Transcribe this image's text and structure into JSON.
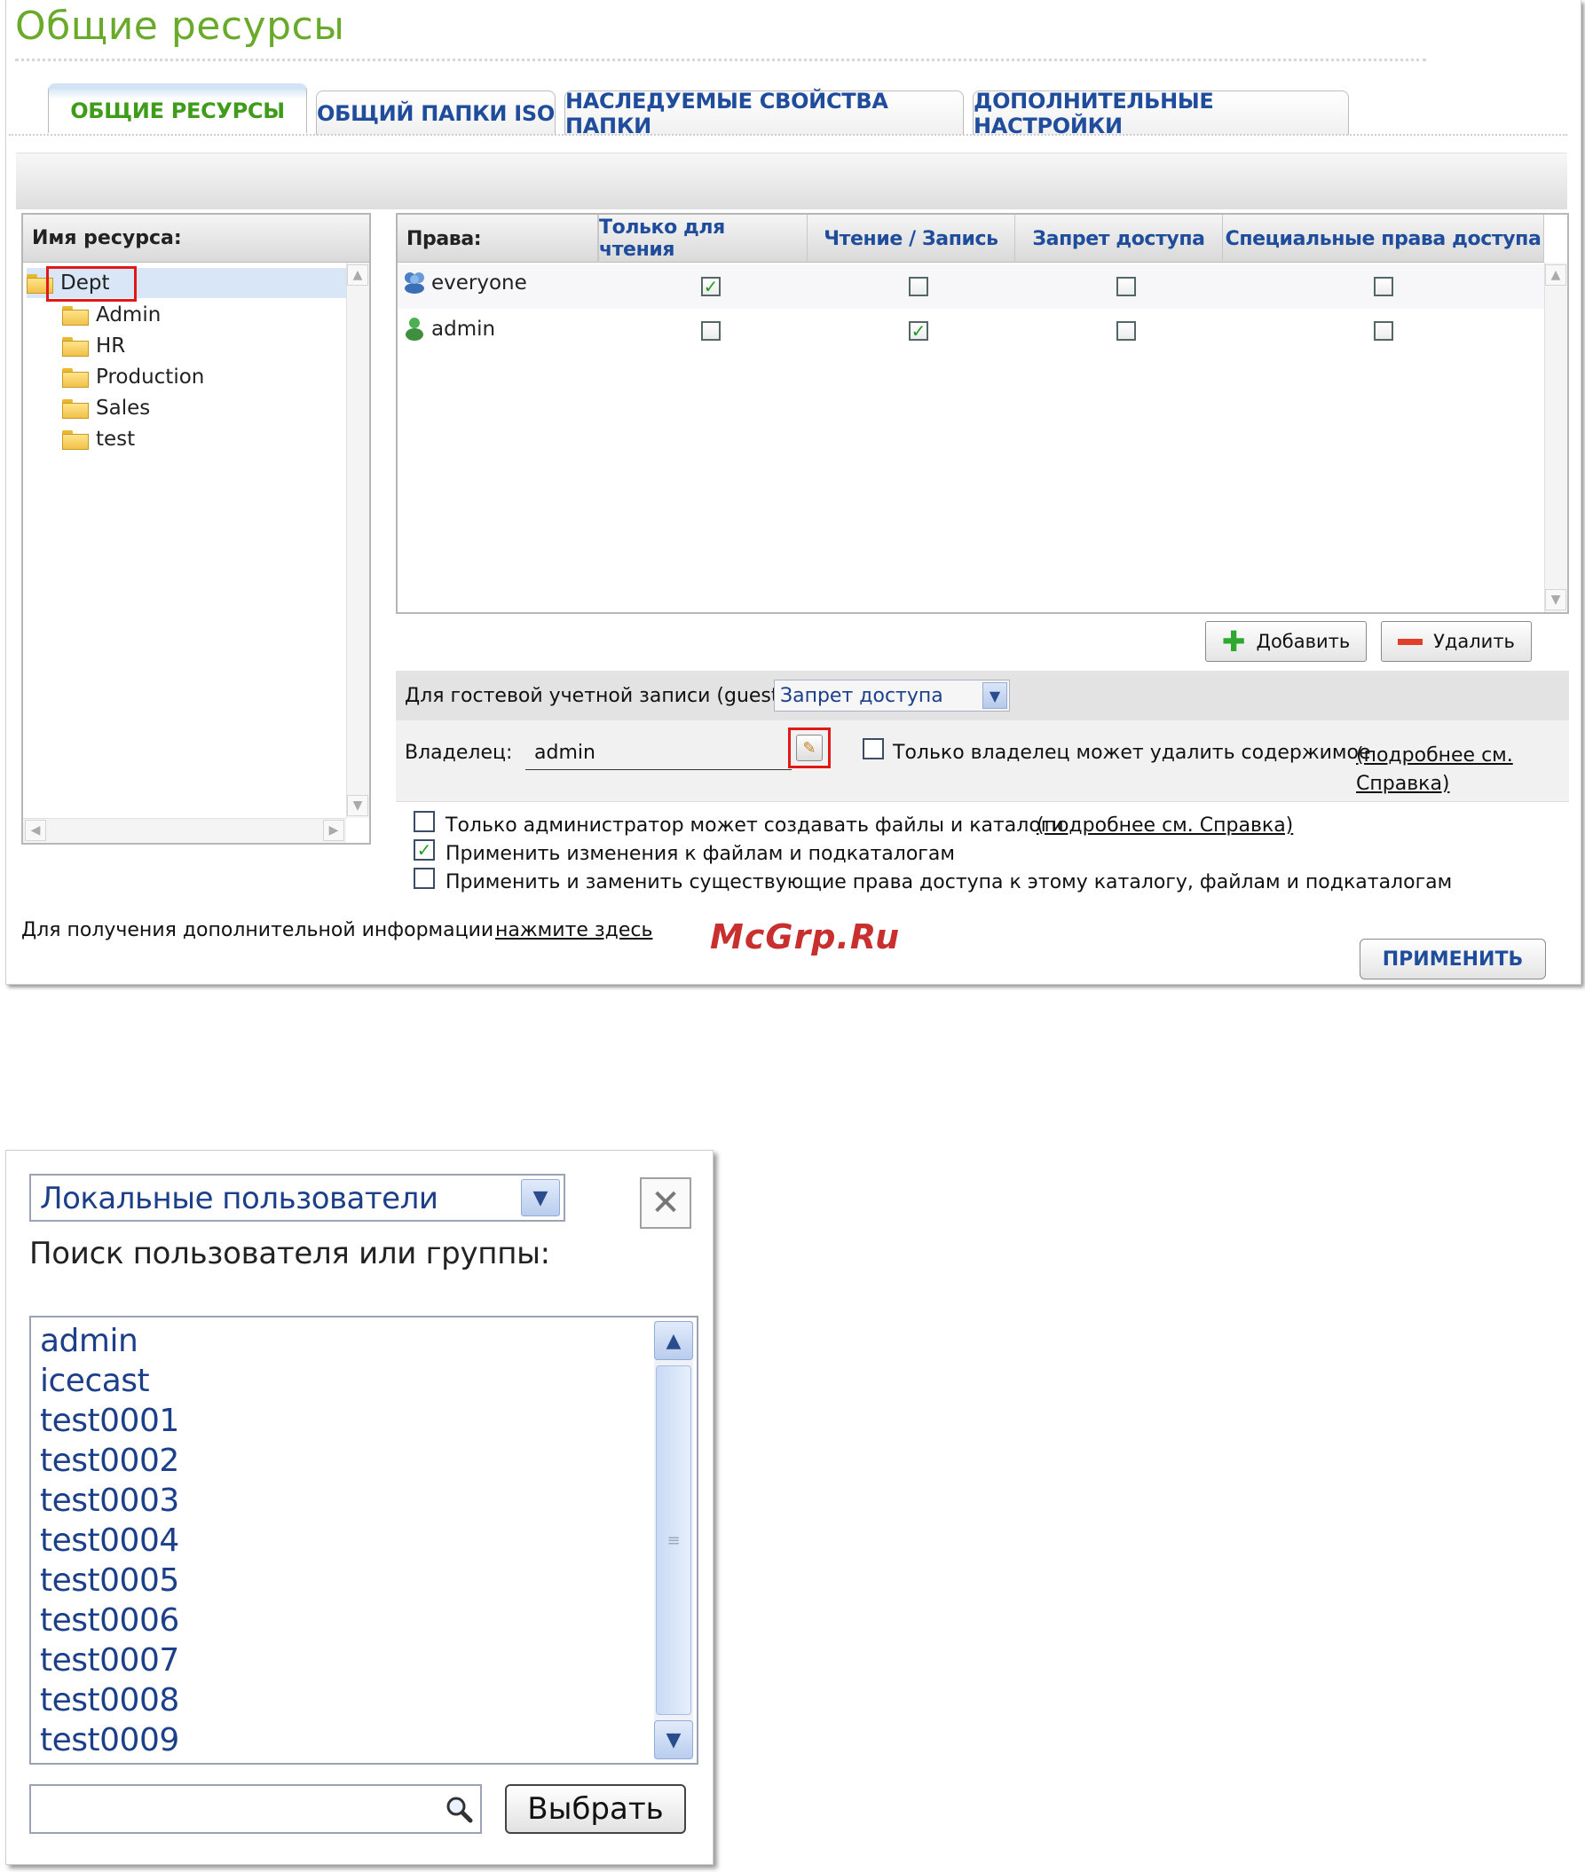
{
  "page_title": "Общие ресурсы",
  "tabs": [
    {
      "label": "ОБЩИЕ РЕСУРСЫ",
      "active": true
    },
    {
      "label": "ОБЩИЙ ПАПКИ ISO",
      "active": false
    },
    {
      "label": "НАСЛЕДУЕМЫЕ СВОЙСТВА ПАПКИ",
      "active": false
    },
    {
      "label": "ДОПОЛНИТЕЛЬНЫЕ НАСТРОЙКИ",
      "active": false
    }
  ],
  "tree": {
    "header": "Имя ресурса:",
    "root": "Dept",
    "children": [
      "Admin",
      "HR",
      "Production",
      "Sales",
      "test"
    ]
  },
  "permissions": {
    "header_label": "Права:",
    "columns": [
      "Только для чтения",
      "Чтение / Запись",
      "Запрет доступа",
      "Специальные права доступа"
    ],
    "rows": [
      {
        "name": "everyone",
        "type": "group",
        "read_only": true,
        "read_write": false,
        "deny": false,
        "special": false
      },
      {
        "name": "admin",
        "type": "user",
        "read_only": false,
        "read_write": true,
        "deny": false,
        "special": false
      }
    ]
  },
  "buttons": {
    "add": "Добавить",
    "remove": "Удалить",
    "apply": "ПРИМЕНИТЬ"
  },
  "guest": {
    "label": "Для гостевой учетной записи (guest):",
    "value": "Запрет доступа"
  },
  "owner": {
    "label": "Владелец:",
    "value": "admin",
    "only_owner_delete": "Только владелец может удалить содержимое",
    "only_owner_delete_checked": false,
    "link": "(подробнее см. Справка)"
  },
  "options": [
    {
      "text": "Только администратор может создавать файлы и каталоги",
      "checked": false,
      "link": "(подробнее см. Справка)"
    },
    {
      "text": "Применить изменения к файлам и подкаталогам",
      "checked": true
    },
    {
      "text": "Применить и заменить существующие права доступа к этому каталогу, файлам и подкаталогам",
      "checked": false
    }
  ],
  "footer": {
    "text": "Для получения дополнительной информации",
    "link": "нажмите здесь"
  },
  "watermark": "McGrp.Ru",
  "dialog": {
    "source_select": "Локальные пользователи",
    "search_label": "Поиск пользователя или группы:",
    "users": [
      "admin",
      "icecast",
      "test0001",
      "test0002",
      "test0003",
      "test0004",
      "test0005",
      "test0006",
      "test0007",
      "test0008",
      "test0009"
    ],
    "search_value": "",
    "select_button": "Выбрать"
  }
}
